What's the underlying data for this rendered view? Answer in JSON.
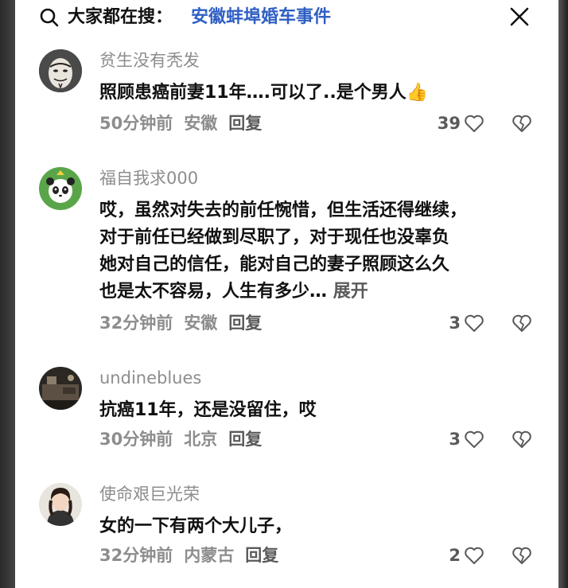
{
  "search": {
    "prefix": "大家都在搜：",
    "query": "安徽蚌埠婚车事件"
  },
  "comments": [
    {
      "username": "贫生没有秃发",
      "text": "照顾患癌前妻11年….可以了..是个男人",
      "emoji": "👍",
      "time": "50分钟前",
      "location": "安徽",
      "reply": "回复",
      "likes": "39",
      "avatar": "mask-avatar"
    },
    {
      "username": "福自我求000",
      "lines": [
        "哎，虽然对失去的前任惋惜，但生活还得继续，",
        "对于前任已经做到尽职了，对于现任也没辜负",
        "她对自己的信任，能对自己的妻子照顾这么久",
        "也是太不容易，人生有多少…"
      ],
      "expand": "展开",
      "time": "32分钟前",
      "location": "安徽",
      "reply": "回复",
      "likes": "3",
      "avatar": "panda-avatar"
    },
    {
      "username": "undineblues",
      "text": "抗癌11年，还是没留住，哎",
      "time": "30分钟前",
      "location": "北京",
      "reply": "回复",
      "likes": "3",
      "avatar": "room-photo-avatar"
    },
    {
      "username": "使命艰巨光荣",
      "text": "女的一下有两个大儿子，",
      "time": "32分钟前",
      "location": "内蒙古",
      "reply": "回复",
      "likes": "2",
      "avatar": "woman-photo-avatar"
    }
  ],
  "colors": {
    "query": "#2f5fc4",
    "meta": "#8d8d8d",
    "text": "#111111"
  }
}
